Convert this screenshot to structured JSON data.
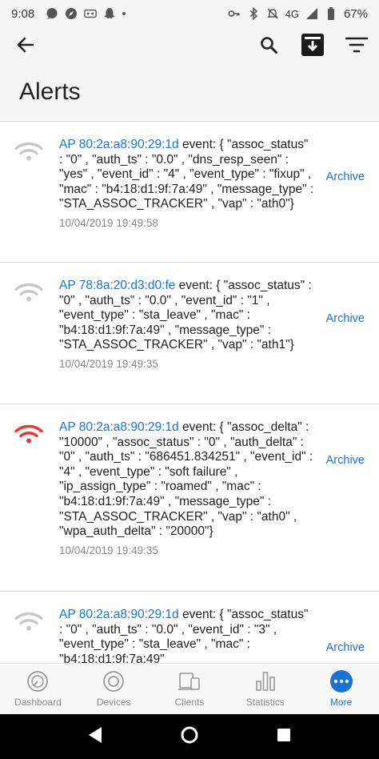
{
  "status_bar": {
    "time": "9:08",
    "network": "4G",
    "battery": "67%",
    "icons": [
      "chat-icon",
      "compass-icon",
      "voicemail-icon",
      "snapchat-icon",
      "dot-icon",
      "key-icon",
      "bluetooth-icon",
      "mute-icon",
      "signal-icon",
      "battery-icon"
    ]
  },
  "header": {
    "title": "Alerts",
    "icons": [
      "back-arrow-icon",
      "search-icon",
      "archive-box-icon",
      "filter-icon"
    ]
  },
  "alerts": [
    {
      "ap": "AP 80:2a:a8:90:29:1d",
      "message": " event: { \"assoc_status\" : \"0\" , \"auth_ts\" : \"0.0\" , \"dns_resp_seen\" : \"yes\" , \"event_id\" : \"4\" , \"event_type\" : \"fixup\" , \"mac\" : \"b4:18:d1:9f:7a:49\" , \"message_type\" : \"STA_ASSOC_TRACKER\" , \"vap\" : \"ath0\"}",
      "timestamp": "10/04/2019 19:49:58",
      "action": "Archive",
      "icon": "wifi-icon",
      "severity_color": "#c8c8c8"
    },
    {
      "ap": "AP 78:8a:20:d3:d0:fe",
      "message": " event: { \"assoc_status\" : \"0\" , \"auth_ts\" : \"0.0\" , \"event_id\" : \"1\" , \"event_type\" : \"sta_leave\" , \"mac\" : \"b4:18:d1:9f:7a:49\" , \"message_type\" : \"STA_ASSOC_TRACKER\" , \"vap\" : \"ath1\"}",
      "timestamp": "10/04/2019 19:49:35",
      "action": "Archive",
      "icon": "wifi-icon",
      "severity_color": "#c8c8c8"
    },
    {
      "ap": "AP 80:2a:a8:90:29:1d",
      "message": " event: { \"assoc_delta\" : \"10000\" , \"assoc_status\" : \"0\" , \"auth_delta\" : \"0\" , \"auth_ts\" : \"686451.834251\" , \"event_id\" : \"4\" , \"event_type\" : \"soft failure\" , \"ip_assign_type\" : \"roamed\" , \"mac\" : \"b4:18:d1:9f:7a:49\" , \"message_type\" : \"STA_ASSOC_TRACKER\" , \"vap\" : \"ath0\" , \"wpa_auth_delta\" : \"20000\"}",
      "timestamp": "10/04/2019 19:49:35",
      "action": "Archive",
      "icon": "wifi-icon",
      "severity_color": "#e53935"
    },
    {
      "ap": "AP 80:2a:a8:90:29:1d",
      "message": " event: { \"assoc_status\" : \"0\" , \"auth_ts\" : \"0.0\" , \"event_id\" : \"3\" , \"event_type\" : \"sta_leave\" , \"mac\" : \"b4:18:d1:9f:7a:49\"",
      "timestamp": "",
      "action": "Archive",
      "icon": "wifi-icon",
      "severity_color": "#c8c8c8"
    }
  ],
  "bottom_nav": {
    "items": [
      {
        "label": "Dashboard",
        "icon": "dashboard-gauge-icon"
      },
      {
        "label": "Devices",
        "icon": "devices-circle-icon"
      },
      {
        "label": "Clients",
        "icon": "clients-devices-icon"
      },
      {
        "label": "Statistics",
        "icon": "statistics-bars-icon"
      },
      {
        "label": "More",
        "icon": "more-dots-icon"
      }
    ],
    "active": "More",
    "accent_color": "#1a73d2"
  },
  "system_nav": {
    "icons": [
      "back-triangle-icon",
      "home-circle-icon",
      "recents-square-icon"
    ]
  }
}
